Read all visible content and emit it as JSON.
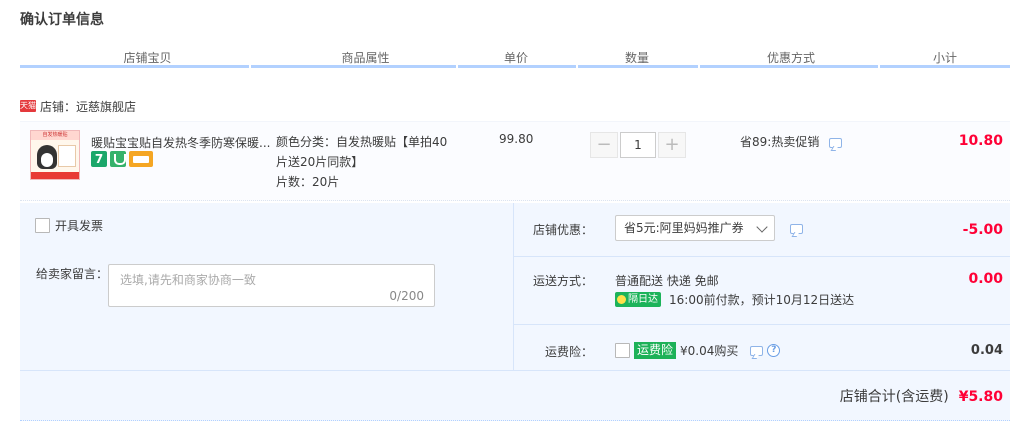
{
  "page_title": "确认订单信息",
  "columns": [
    "店铺宝贝",
    "商品属性",
    "单价",
    "数量",
    "优惠方式",
    "小计"
  ],
  "shop": {
    "badge": "天猫",
    "label": "店铺：远慈旗舰店"
  },
  "item": {
    "thumb_text": "自发热暖贴",
    "title": "暖贴宝宝贴自发热冬季防寒保暖...",
    "service_icons": [
      "seven-day-return-icon",
      "shield-icon",
      "card-icon"
    ],
    "attr_line1": "颜色分类：自发热暖贴【单拍40",
    "attr_line2": "片送20片同款】",
    "attr_line3": "片数：20片",
    "price": "99.80",
    "quantity": "1",
    "minus": "−",
    "plus": "+",
    "promo": "省89:热卖促销",
    "subtotal": "10.80"
  },
  "invoice_label": "开具发票",
  "message": {
    "label": "给卖家留言：",
    "placeholder": "选填,请先和商家协商一致",
    "count": "0/200"
  },
  "shop_discount": {
    "label": "店铺优惠：",
    "selected": "省5元:阿里妈妈推广券",
    "amount": "-5.00"
  },
  "shipping": {
    "label": "运送方式：",
    "line1": "普通配送 快递 免邮",
    "fast_badge": "隔日达",
    "line2": "16:00前付款，预计10月12日送达",
    "amount": "0.00"
  },
  "insurance": {
    "label": "运费险：",
    "badge": "运费险",
    "text": "¥0.04购买",
    "help": "?",
    "amount": "0.04"
  },
  "total": {
    "label": "店铺合计(含运费)",
    "amount": "¥5.80"
  },
  "colors": {
    "accent_red": "#ff0036",
    "header_line": "#b2d1ff",
    "panel_bg": "#f2f7ff",
    "green": "#1db158"
  }
}
